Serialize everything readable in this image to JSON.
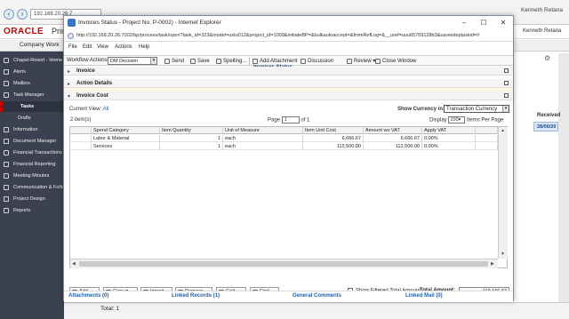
{
  "background": {
    "url": "192.168.20.26:7",
    "user": "Kenneth Retana",
    "oracle": "ORACLE",
    "prim_text": "Prim",
    "kenneth": "Kenneth Retana",
    "company": "Company Work",
    "received": "Received",
    "received_date": "28/06/20",
    "total_label": "Total: 1",
    "sidebar": [
      {
        "label": "Chapel-Resort - Home",
        "sub": false,
        "active": false
      },
      {
        "label": "Alerts",
        "sub": false,
        "active": false
      },
      {
        "label": "Mailbox",
        "sub": false,
        "active": false
      },
      {
        "label": "Task Manager",
        "sub": false,
        "active": false
      },
      {
        "label": "Tasks",
        "sub": true,
        "active": true
      },
      {
        "label": "Drafts",
        "sub": true,
        "active": false
      },
      {
        "label": "Information",
        "sub": false,
        "active": false
      },
      {
        "label": "Document Manager",
        "sub": false,
        "active": false
      },
      {
        "label": "Financial Transactions",
        "sub": false,
        "active": false
      },
      {
        "label": "Financial Reporting",
        "sub": false,
        "active": false
      },
      {
        "label": "Meeting Minutes",
        "sub": false,
        "active": false
      },
      {
        "label": "Communication & Follo",
        "sub": false,
        "active": false
      },
      {
        "label": "Project Design",
        "sub": false,
        "active": false
      },
      {
        "label": "Reports",
        "sub": false,
        "active": false
      }
    ]
  },
  "modal": {
    "title": "Invoices Status - Project No. P-0002) - Internet Explorer",
    "url": "http://192.168.20.26:7002/bp/process/task/open?task_id=323&model=uxtu012&project_id=1009&initiateBP=&bulkautoaccept=&fromRefLog=&__uref=uuu65769128b3&saveisteptaskid=#",
    "menu": [
      "File",
      "Edit",
      "View",
      "Actions",
      "Help"
    ],
    "toolbar": {
      "workflow_label": "Workflow Actions",
      "workflow_value": "DM Decisión",
      "send": "Send",
      "save": "Save",
      "spelling": "Spelling...",
      "add_attachment": "Add Attachment",
      "discussion": "Discussion",
      "review": "Review",
      "close_window": "Close Window"
    },
    "form_title": "Invoices Status",
    "sections": {
      "invoice": "Invoice",
      "action_details": "Action Details",
      "invoice_cost": "Invoice Cost"
    },
    "cost": {
      "current_view_label": "Current View:",
      "current_view_value": "All",
      "show_currency_label": "Show Currency in:",
      "currency_value": "Transaction Currency",
      "items": "2  item(s)",
      "page_label": "Page",
      "page_value": "1",
      "of_label": "of",
      "page_total": "1",
      "display_label": "Display",
      "display_value": "100",
      "per_page_label": "Items Per Page",
      "columns": [
        "",
        "Spend Category",
        "Item Quantity",
        "Unit of Measure",
        "Item Unit Cost",
        "Amount wo VAT",
        "Apply VAT",
        ""
      ],
      "rows": [
        [
          "",
          "Labor & Material",
          "1",
          "each",
          "6,666.67",
          "6,666.67",
          "0.00%",
          ""
        ],
        [
          "",
          "Services",
          "1",
          "each",
          "112,500.00",
          "112,500.00",
          "0.00%",
          ""
        ]
      ],
      "buttons": {
        "add": "Add",
        "copy": "Copy",
        "import": "Import",
        "remove": "Remove",
        "grid": "Grid",
        "find": "Find"
      },
      "show_filtered_label": "Show Filtered Total Amount",
      "total_amount_label": "Total Amount:",
      "total_amount_value": "119,166.67"
    },
    "footer": {
      "attachments": "Attachments (0)",
      "linked_records": "Linked Records (1)",
      "general_comments": "General Comments",
      "linked_mail": "Linked Mail (0)"
    }
  }
}
